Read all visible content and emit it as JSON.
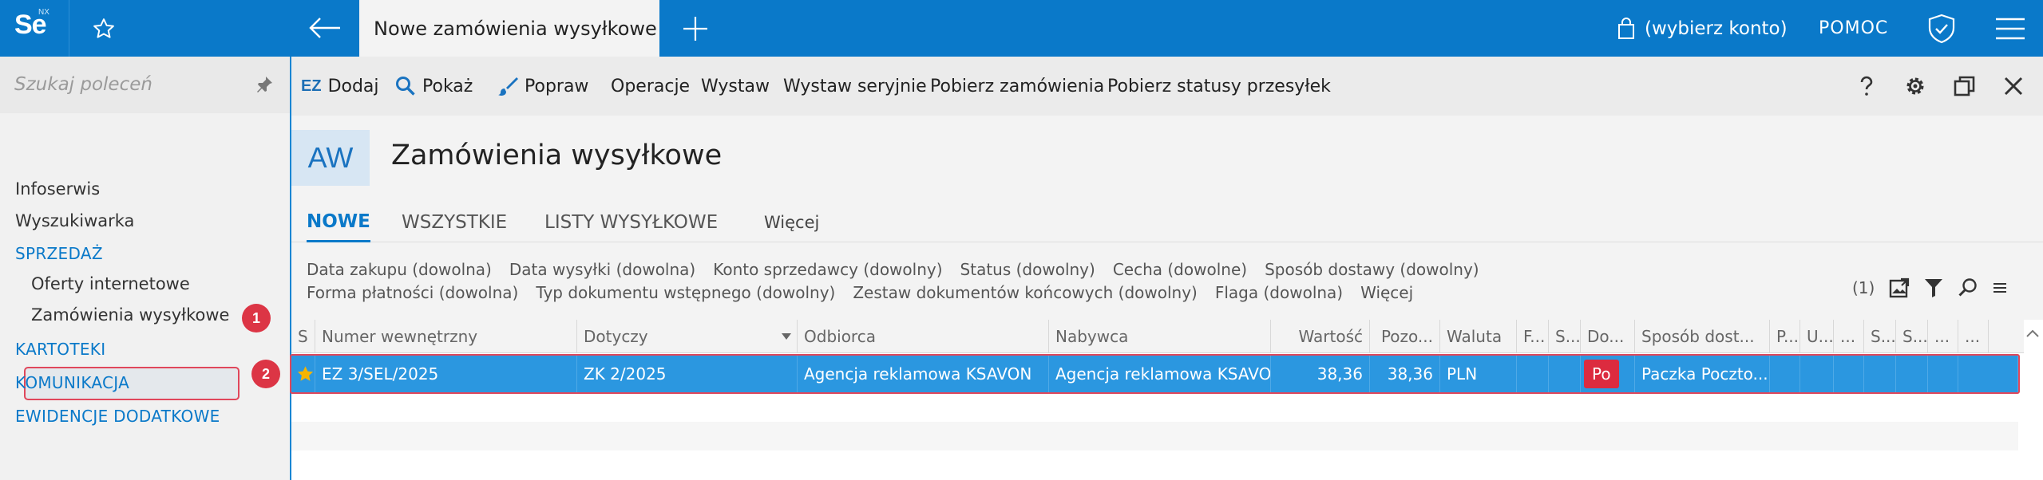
{
  "app": {
    "logo_text": "Se",
    "logo_sup": "NX",
    "favorites_icon": "star-outline-icon",
    "back_icon": "arrow-left-icon",
    "active_tab_title": "Nowe zamówienia wysyłkowe",
    "new_tab_icon": "plus-icon",
    "account_label": "(wybierz konto)",
    "help_label": "POMOC",
    "accent_color": "#0a79c9"
  },
  "sidebar": {
    "search_placeholder": "Szukaj poleceń",
    "items": [
      {
        "label": "Infoserwis",
        "type": "item"
      },
      {
        "label": "Wyszukiwarka",
        "type": "item"
      },
      {
        "label": "SPRZEDAŻ",
        "type": "section"
      },
      {
        "label": "Oferty internetowe",
        "type": "sub"
      },
      {
        "label": "Zamówienia wysyłkowe",
        "type": "sub",
        "selected": true
      },
      {
        "label": "KARTOTEKI",
        "type": "section"
      },
      {
        "label": "KOMUNIKACJA",
        "type": "section"
      },
      {
        "label": "EWIDENCJE DODATKOWE",
        "type": "section"
      }
    ],
    "badge_1": "1"
  },
  "toolbar": {
    "ez_label": "EZ",
    "add_label": "Dodaj",
    "show_label": "Pokaż",
    "edit_label": "Popraw",
    "operations_label": "Operacje",
    "issue_label": "Wystaw",
    "issue_serial_label": "Wystaw seryjnie",
    "fetch_orders_label": "Pobierz zamówienia",
    "fetch_statuses_label": "Pobierz statusy przesyłek"
  },
  "header": {
    "code": "AW",
    "title": "Zamówienia wysyłkowe"
  },
  "tabs": [
    {
      "label": "NOWE",
      "active": true
    },
    {
      "label": "WSZYSTKIE",
      "active": false
    },
    {
      "label": "LISTY WYSYŁKOWE",
      "active": false
    },
    {
      "label": "Więcej",
      "active": false
    }
  ],
  "filters": {
    "line1": [
      "Data zakupu (dowolna)",
      "Data wysyłki (dowolna)",
      "Konto sprzedawcy (dowolny)",
      "Status (dowolny)",
      "Cecha (dowolne)",
      "Sposób dostawy (dowolny)"
    ],
    "line2": [
      "Forma płatności (dowolna)",
      "Typ dokumentu wstępnego (dowolny)",
      "Zestaw dokumentów końcowych (dowolny)",
      "Flaga (dowolna)",
      "Więcej"
    ],
    "count": "(1)"
  },
  "grid": {
    "columns": [
      "S",
      "Numer wewnętrzny",
      "Dotyczy",
      "Odbiorca",
      "Nabywca",
      "Wartość",
      "Pozo...",
      "Waluta",
      "F...",
      "S...",
      "Do...",
      "Sposób dost...",
      "P...",
      "U...",
      "...",
      "S...",
      "S...",
      "...",
      "..."
    ],
    "rows": [
      {
        "numer": "EZ 3/SEL/2025",
        "dotyczy": "ZK 2/2025",
        "odbiorca": "Agencja reklamowa KSAVON",
        "nabywca": "Agencja reklamowa KSAVON",
        "wartosc": "38,36",
        "pozostalo": "38,36",
        "waluta": "PLN",
        "dok_badge": "Po",
        "sposob_dostawy": "Paczka Poczto..."
      }
    ],
    "badge_2": "2"
  }
}
